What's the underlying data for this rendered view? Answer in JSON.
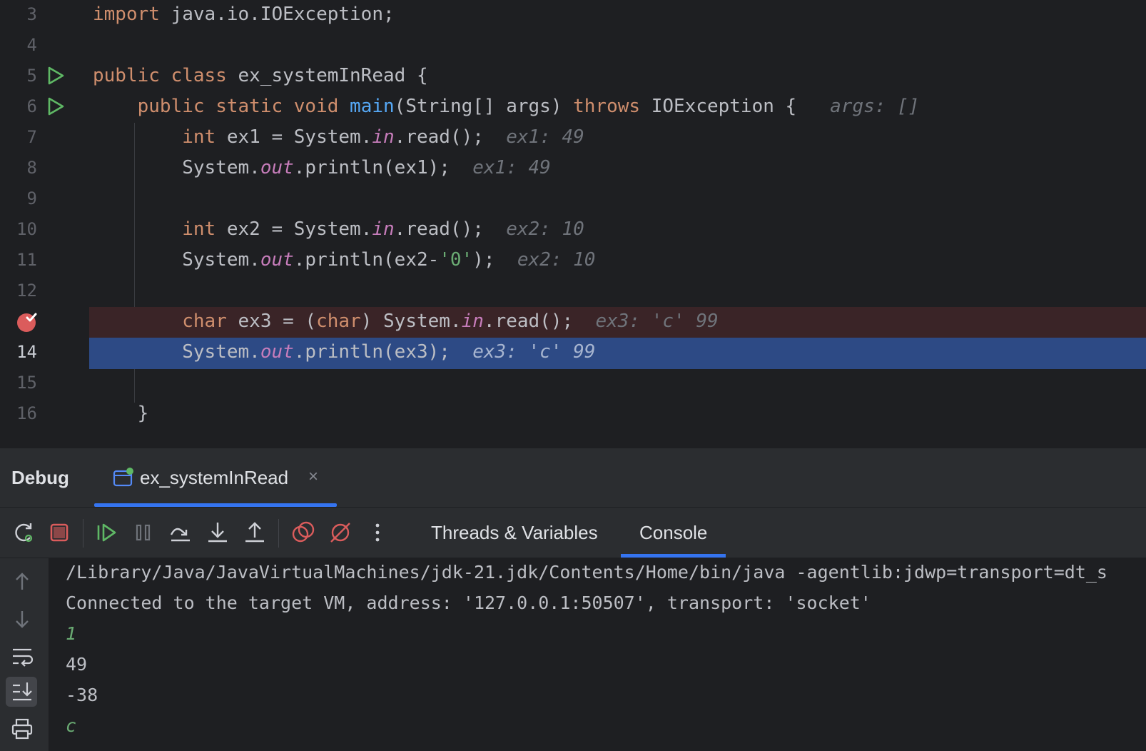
{
  "editor": {
    "lines": [
      {
        "num": "3",
        "code": "import java.io.IOException;"
      },
      {
        "num": "4",
        "code": ""
      },
      {
        "num": "5",
        "code": "public class ex_systemInRead {"
      },
      {
        "num": "6",
        "code": "    public static void main(String[] args) throws IOException {",
        "hint": "args: []"
      },
      {
        "num": "7",
        "code": "        int ex1 = System.in.read();",
        "hint": "ex1: 49"
      },
      {
        "num": "8",
        "code": "        System.out.println(ex1);",
        "hint": "ex1: 49"
      },
      {
        "num": "9",
        "code": ""
      },
      {
        "num": "10",
        "code": "        int ex2 = System.in.read();",
        "hint": "ex2: 10"
      },
      {
        "num": "11",
        "code": "        System.out.println(ex2-'0');",
        "hint": "ex2: 10"
      },
      {
        "num": "12",
        "code": ""
      },
      {
        "num": "13",
        "code": "        char ex3 = (char) System.in.read();",
        "hint": "ex3: 'c' 99"
      },
      {
        "num": "14",
        "code": "        System.out.println(ex3);",
        "hint": "ex3: 'c' 99"
      },
      {
        "num": "15",
        "code": ""
      },
      {
        "num": "16",
        "code": "    }"
      }
    ]
  },
  "debug": {
    "title": "Debug",
    "session_tab": "ex_systemInRead",
    "close_glyph": "×",
    "toolbar": {
      "icons": [
        "rerun-icon",
        "stop-icon",
        "resume-icon",
        "pause-icon",
        "step-over-icon",
        "step-into-icon",
        "step-out-icon",
        "view-breakpoints-icon",
        "mute-breakpoints-icon",
        "more-icon"
      ]
    },
    "tabs": {
      "threads": "Threads & Variables",
      "console": "Console"
    }
  },
  "console": {
    "lines": [
      {
        "text": "/Library/Java/JavaVirtualMachines/jdk-21.jdk/Contents/Home/bin/java -agentlib:jdwp=transport=dt_s",
        "type": "output"
      },
      {
        "text": "Connected to the target VM, address: '127.0.0.1:50507', transport: 'socket'",
        "type": "output"
      },
      {
        "text": "1",
        "type": "input"
      },
      {
        "text": "49",
        "type": "output"
      },
      {
        "text": "-38",
        "type": "output"
      },
      {
        "text": "c",
        "type": "input"
      }
    ]
  },
  "colors": {
    "keyword": "#cf8e6d",
    "method": "#56a8f5",
    "static_field": "#c77dbb",
    "string": "#6aab73",
    "execution_line": "#2d4a85",
    "breakpoint_line": "#3a2427",
    "accent": "#3574f0"
  }
}
